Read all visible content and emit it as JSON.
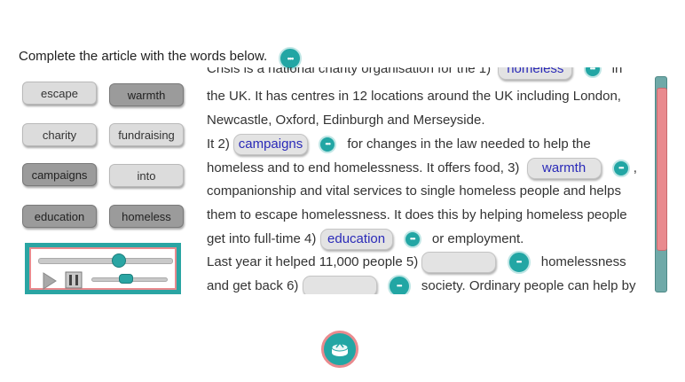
{
  "instruction": "Complete the article with the words below.",
  "icons": {
    "audio_dots": "ellipsis-icon",
    "play": "play-icon",
    "pause": "pause-icon",
    "home": "home-icon"
  },
  "colors": {
    "teal": "#22a6a4",
    "pink": "#e98a8e",
    "gap_text": "#2a2ab8"
  },
  "word_bank": [
    "escape",
    "warmth",
    "charity",
    "fundraising",
    "campaigns",
    "into",
    "education",
    "homeless"
  ],
  "player": {
    "progress": 0.6,
    "volume": 0.45
  },
  "article": {
    "line0": "Crisis is a national charity organisation for the 1)",
    "gap1": "homeless",
    "line0_tail": "in",
    "line1": "the UK. It has centres in 12 locations around the UK including London,",
    "line2": "Newcastle, Oxford, Edinburgh and Merseyside.",
    "line3_a": "It 2)",
    "gap2": "campaigns",
    "line3_b": "for changes in the law needed to help the",
    "line4_a": "homeless and to end homelessness. It offers food, 3)",
    "gap3": "warmth",
    "line4_b": ",",
    "line5": "companionship and vital services to single homeless people and helps",
    "line6": "them to escape homelessness. It does this by helping homeless people",
    "line7_a": "get into full-time 4)",
    "gap4": "education",
    "line7_b": "or employment.",
    "line8_a": "Last year it helped 11,000 people 5)",
    "gap5": "",
    "line8_b": "homelessness",
    "line9_a": "and get back 6)",
    "gap6": "",
    "line9_b": "society. Ordinary people can help by"
  }
}
